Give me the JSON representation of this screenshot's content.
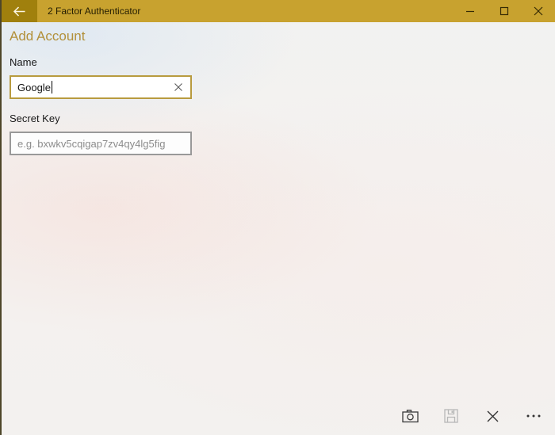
{
  "window": {
    "title": "2 Factor Authenticator",
    "controls": {
      "back_icon": "left-arrow",
      "minimize_icon": "minimize-dash",
      "maximize_icon": "maximize-square",
      "close_icon": "close-x"
    }
  },
  "page": {
    "title": "Add Account"
  },
  "form": {
    "name": {
      "label": "Name",
      "value": "Google",
      "clear_icon": "clear-x",
      "focused": true
    },
    "secret_key": {
      "label": "Secret Key",
      "value": "",
      "placeholder": "e.g. bxwkv5cqigap7zv4qy4lg5fig"
    }
  },
  "command_bar": {
    "camera_icon": "camera",
    "save_icon": "floppy-disk",
    "save_enabled": false,
    "cancel_icon": "close-x",
    "more_icon": "ellipsis"
  },
  "colors": {
    "titlebar": "#c8a22f",
    "back_button": "#a0800d",
    "accent_heading": "#b2903a",
    "focused_border": "#b89b3f",
    "idle_border": "#999999",
    "disabled_icon": "#b7b7b7",
    "icon": "#3a3a3a"
  }
}
